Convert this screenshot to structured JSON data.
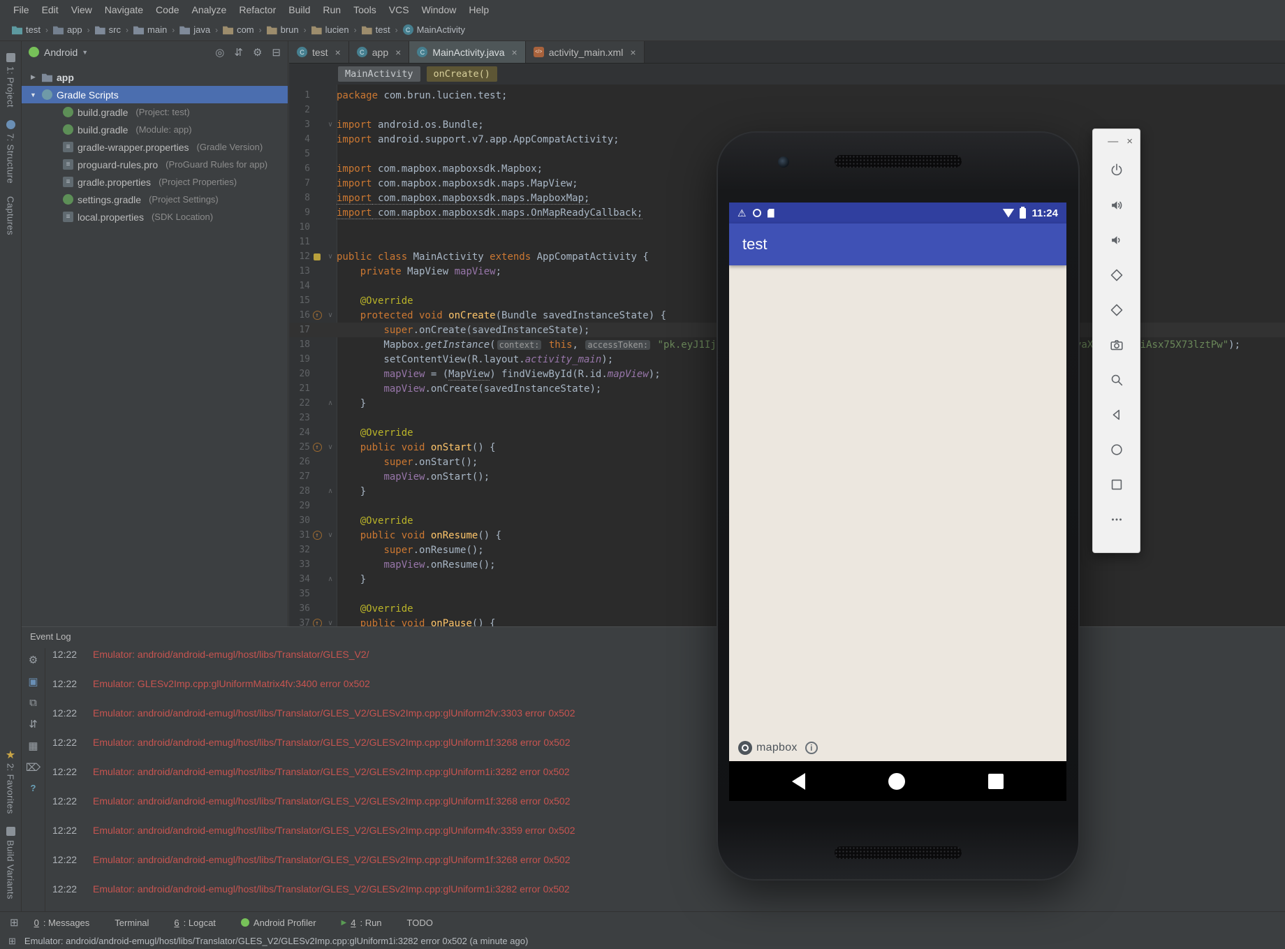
{
  "colors": {
    "selection_blue": "#4b6eaf",
    "error_red": "#c75450",
    "appbar_indigo": "#3f51b5",
    "statusbar_indigo": "#303f9f",
    "keyword_orange": "#cc7832",
    "string_green": "#6a8759"
  },
  "menu_bar": {
    "items": [
      "File",
      "Edit",
      "View",
      "Navigate",
      "Code",
      "Analyze",
      "Refactor",
      "Build",
      "Run",
      "Tools",
      "VCS",
      "Window",
      "Help"
    ]
  },
  "nav_breadcrumbs": {
    "separator": "›",
    "items": [
      {
        "label": "test",
        "icon": "project-icon"
      },
      {
        "label": "app",
        "icon": "module-icon"
      },
      {
        "label": "src",
        "icon": "folder-icon"
      },
      {
        "label": "main",
        "icon": "folder-icon"
      },
      {
        "label": "java",
        "icon": "folder-icon"
      },
      {
        "label": "com",
        "icon": "package-icon"
      },
      {
        "label": "brun",
        "icon": "package-icon"
      },
      {
        "label": "lucien",
        "icon": "package-icon"
      },
      {
        "label": "test",
        "icon": "package-icon"
      },
      {
        "label": "MainActivity",
        "icon": "class-icon"
      }
    ]
  },
  "left_strip": {
    "top": [
      {
        "label": "1: Project",
        "icon": "project-tool-icon"
      },
      {
        "label": "7: Structure",
        "icon": "structure-tool-icon"
      },
      {
        "label": "Captures",
        "icon": null
      }
    ],
    "bottom": [
      {
        "label": "2: Favorites",
        "icon": "star-icon"
      },
      {
        "label": "Build Variants",
        "icon": "variants-icon"
      }
    ]
  },
  "project_panel": {
    "mode": "Android",
    "actions": [
      "locate-icon",
      "collapse-all-icon",
      "settings-icon",
      "hide-panel-icon"
    ],
    "tree": [
      {
        "label": "app",
        "hint": "",
        "icon": "folder-icon",
        "chevron": "▶",
        "indent": 0,
        "selected": false,
        "bold": true
      },
      {
        "label": "Gradle Scripts",
        "hint": "",
        "icon": "gradle-icon",
        "chevron": "▼",
        "indent": 0,
        "selected": true,
        "bold": false
      },
      {
        "label": "build.gradle",
        "hint": "(Project: test)",
        "icon": "gradle-file-icon",
        "chevron": "",
        "indent": 1
      },
      {
        "label": "build.gradle",
        "hint": "(Module: app)",
        "icon": "gradle-file-icon",
        "chevron": "",
        "indent": 1
      },
      {
        "label": "gradle-wrapper.properties",
        "hint": "(Gradle Version)",
        "icon": "properties-icon",
        "chevron": "",
        "indent": 1
      },
      {
        "label": "proguard-rules.pro",
        "hint": "(ProGuard Rules for app)",
        "icon": "properties-icon",
        "chevron": "",
        "indent": 1
      },
      {
        "label": "gradle.properties",
        "hint": "(Project Properties)",
        "icon": "properties-icon",
        "chevron": "",
        "indent": 1
      },
      {
        "label": "settings.gradle",
        "hint": "(Project Settings)",
        "icon": "gradle-file-icon",
        "chevron": "",
        "indent": 1
      },
      {
        "label": "local.properties",
        "hint": "(SDK Location)",
        "icon": "properties-icon",
        "chevron": "",
        "indent": 1
      }
    ]
  },
  "editor": {
    "close_glyph": "×",
    "tabs": [
      {
        "label": "test",
        "icon": "class-icon",
        "active": false
      },
      {
        "label": "app",
        "icon": "class-icon",
        "active": false
      },
      {
        "label": "MainActivity.java",
        "icon": "class-icon",
        "active": true
      },
      {
        "label": "activity_main.xml",
        "icon": "xml-icon",
        "active": false
      }
    ],
    "breadcrumbs": [
      {
        "label": "MainActivity",
        "style": "class"
      },
      {
        "label": "onCreate()",
        "style": "method"
      }
    ],
    "code": [
      {
        "n": 1,
        "segs": [
          [
            "k",
            "package"
          ],
          [
            "p",
            " com.brun.lucien.test;"
          ]
        ]
      },
      {
        "n": 2,
        "segs": []
      },
      {
        "n": 3,
        "segs": [
          [
            "k",
            "import"
          ],
          [
            "p",
            " android.os.Bundle;"
          ]
        ]
      },
      {
        "n": 4,
        "segs": [
          [
            "k",
            "import"
          ],
          [
            "p",
            " android.support.v7.app.AppCompatActivity;"
          ]
        ]
      },
      {
        "n": 5,
        "segs": []
      },
      {
        "n": 6,
        "segs": [
          [
            "k",
            "import"
          ],
          [
            "p",
            " com.mapbox.mapboxsdk.Mapbox;"
          ]
        ]
      },
      {
        "n": 7,
        "segs": [
          [
            "k",
            "import"
          ],
          [
            "p",
            " com.mapbox.mapboxsdk.maps.MapView;"
          ]
        ]
      },
      {
        "n": 8,
        "segs": [
          [
            "k u",
            "import"
          ],
          [
            "p u",
            " com.mapbox.mapboxsdk.maps.MapboxMap;"
          ]
        ]
      },
      {
        "n": 9,
        "segs": [
          [
            "k u",
            "import"
          ],
          [
            "p u",
            " com.mapbox.mapboxsdk.maps.OnMapReadyCallback;"
          ]
        ]
      },
      {
        "n": 10,
        "segs": []
      },
      {
        "n": 11,
        "segs": []
      },
      {
        "n": 12,
        "segs": [
          [
            "k",
            "public class "
          ],
          [
            "p",
            "MainActivity "
          ],
          [
            "k",
            "extends"
          ],
          [
            "p",
            " AppCompatActivity {"
          ]
        ]
      },
      {
        "n": 13,
        "segs": [
          [
            "p",
            "    "
          ],
          [
            "k",
            "private"
          ],
          [
            "p",
            " MapView "
          ],
          [
            "f",
            "mapView"
          ],
          [
            "p",
            ";"
          ]
        ]
      },
      {
        "n": 14,
        "segs": []
      },
      {
        "n": 15,
        "segs": [
          [
            "p",
            "    "
          ],
          [
            "a",
            "@Override"
          ]
        ]
      },
      {
        "n": 16,
        "segs": [
          [
            "p",
            "    "
          ],
          [
            "k",
            "protected void "
          ],
          [
            "m",
            "onCreate"
          ],
          [
            "p",
            "(Bundle savedInstanceState) {"
          ]
        ]
      },
      {
        "n": 17,
        "cur": true,
        "segs": [
          [
            "p",
            "        "
          ],
          [
            "k",
            "super"
          ],
          [
            "p",
            ".onCreate(savedInstanceState);"
          ]
        ]
      },
      {
        "n": 18,
        "segs": [
          [
            "p",
            "        Mapbox."
          ],
          [
            "st",
            "getInstance"
          ],
          [
            "p",
            "("
          ],
          [
            "h",
            "context:"
          ],
          [
            "p",
            " "
          ],
          [
            "k",
            "this"
          ],
          [
            "p",
            ", "
          ],
          [
            "h",
            "accessToken:"
          ],
          [
            "p",
            " "
          ],
          [
            "s",
            "\"pk.eyJ1IjoibHVjaWVuYnJ1biIsImEiOiJjajRrOGJtZnIwMHZnMnFxY2pnN2g3YnV2X3RvaXNlciJ9.GiAsx75X73lztPw\""
          ],
          [
            "p",
            ");"
          ]
        ]
      },
      {
        "n": 19,
        "segs": [
          [
            "p",
            "        setContentView(R.layout."
          ],
          [
            "i",
            "activity_main"
          ],
          [
            "p",
            ");"
          ]
        ]
      },
      {
        "n": 20,
        "segs": [
          [
            "p",
            "        "
          ],
          [
            "f",
            "mapView"
          ],
          [
            "p",
            " = ("
          ],
          [
            "p u",
            "MapView"
          ],
          [
            "p",
            ") findViewById(R.id."
          ],
          [
            "i",
            "mapView"
          ],
          [
            "p",
            ");"
          ]
        ]
      },
      {
        "n": 21,
        "segs": [
          [
            "p",
            "        "
          ],
          [
            "f",
            "mapView"
          ],
          [
            "p",
            ".onCreate(savedInstanceState);"
          ]
        ]
      },
      {
        "n": 22,
        "segs": [
          [
            "p",
            "    }"
          ]
        ]
      },
      {
        "n": 23,
        "segs": []
      },
      {
        "n": 24,
        "segs": [
          [
            "p",
            "    "
          ],
          [
            "a",
            "@Override"
          ]
        ]
      },
      {
        "n": 25,
        "segs": [
          [
            "p",
            "    "
          ],
          [
            "k",
            "public void "
          ],
          [
            "m",
            "onStart"
          ],
          [
            "p",
            "() {"
          ]
        ]
      },
      {
        "n": 26,
        "segs": [
          [
            "p",
            "        "
          ],
          [
            "k",
            "super"
          ],
          [
            "p",
            ".onStart();"
          ]
        ]
      },
      {
        "n": 27,
        "segs": [
          [
            "p",
            "        "
          ],
          [
            "f",
            "mapView"
          ],
          [
            "p",
            ".onStart();"
          ]
        ]
      },
      {
        "n": 28,
        "segs": [
          [
            "p",
            "    }"
          ]
        ]
      },
      {
        "n": 29,
        "segs": []
      },
      {
        "n": 30,
        "segs": [
          [
            "p",
            "    "
          ],
          [
            "a",
            "@Override"
          ]
        ]
      },
      {
        "n": 31,
        "segs": [
          [
            "p",
            "    "
          ],
          [
            "k",
            "public void "
          ],
          [
            "m",
            "onResume"
          ],
          [
            "p",
            "() {"
          ]
        ]
      },
      {
        "n": 32,
        "segs": [
          [
            "p",
            "        "
          ],
          [
            "k",
            "super"
          ],
          [
            "p",
            ".onResume();"
          ]
        ]
      },
      {
        "n": 33,
        "segs": [
          [
            "p",
            "        "
          ],
          [
            "f",
            "mapView"
          ],
          [
            "p",
            ".onResume();"
          ]
        ]
      },
      {
        "n": 34,
        "segs": [
          [
            "p",
            "    }"
          ]
        ]
      },
      {
        "n": 35,
        "segs": []
      },
      {
        "n": 36,
        "segs": [
          [
            "p",
            "    "
          ],
          [
            "a",
            "@Override"
          ]
        ]
      },
      {
        "n": 37,
        "segs": [
          [
            "p",
            "    "
          ],
          [
            "k",
            "public void "
          ],
          [
            "m",
            "onPause"
          ],
          [
            "p",
            "() {"
          ]
        ]
      }
    ]
  },
  "event_log": {
    "title": "Event Log",
    "toolbar_icons": [
      "settings-icon",
      "monitor-icon",
      "windows-icon",
      "wrap-icon",
      "grid-icon",
      "clear-icon",
      "help-icon"
    ],
    "entries": [
      {
        "time": "12:22",
        "msg": "Emulator: android/android-emugl/host/libs/Translator/GLES_V2/"
      },
      {
        "time": "12:22",
        "msg": "Emulator: GLESv2Imp.cpp:glUniformMatrix4fv:3400 error 0x502"
      },
      {
        "time": "12:22",
        "msg": "Emulator: android/android-emugl/host/libs/Translator/GLES_V2/GLESv2Imp.cpp:glUniform2fv:3303 error 0x502"
      },
      {
        "time": "12:22",
        "msg": "Emulator: android/android-emugl/host/libs/Translator/GLES_V2/GLESv2Imp.cpp:glUniform1f:3268 error 0x502"
      },
      {
        "time": "12:22",
        "msg": "Emulator: android/android-emugl/host/libs/Translator/GLES_V2/GLESv2Imp.cpp:glUniform1i:3282 error 0x502"
      },
      {
        "time": "12:22",
        "msg": "Emulator: android/android-emugl/host/libs/Translator/GLES_V2/GLESv2Imp.cpp:glUniform1f:3268 error 0x502"
      },
      {
        "time": "12:22",
        "msg": "Emulator: android/android-emugl/host/libs/Translator/GLES_V2/GLESv2Imp.cpp:glUniform4fv:3359 error 0x502"
      },
      {
        "time": "12:22",
        "msg": "Emulator: android/android-emugl/host/libs/Translator/GLES_V2/GLESv2Imp.cpp:glUniform1f:3268 error 0x502"
      },
      {
        "time": "12:22",
        "msg": "Emulator: android/android-emugl/host/libs/Translator/GLES_V2/GLESv2Imp.cpp:glUniform1i:3282 error 0x502"
      }
    ]
  },
  "tool_window_bar": {
    "items": [
      {
        "key": "0",
        "label": ": Messages",
        "icon": null
      },
      {
        "key": null,
        "label": "Terminal",
        "icon": null
      },
      {
        "key": "6",
        "label": ": Logcat",
        "icon": null
      },
      {
        "key": null,
        "label": "Android Profiler",
        "icon": "profiler-icon"
      },
      {
        "key": "4",
        "label": ": Run",
        "icon": "run-icon"
      },
      {
        "key": null,
        "label": "TODO",
        "icon": null
      }
    ]
  },
  "status_bar": {
    "text": "Emulator: android/android-emugl/host/libs/Translator/GLES_V2/GLESv2Imp.cpp:glUniform1i:3282 error 0x502 (a minute ago)"
  },
  "emulator": {
    "app_title": "test",
    "status_time": "11:24",
    "map_brand": "mapbox",
    "info_glyph": "i",
    "window_buttons": {
      "minimize": "—",
      "close": "×"
    },
    "toolbar_icons": [
      "power",
      "volume-up",
      "volume-down",
      "rotate-left",
      "rotate-right",
      "camera",
      "zoom",
      "back",
      "home",
      "overview",
      "more"
    ]
  }
}
